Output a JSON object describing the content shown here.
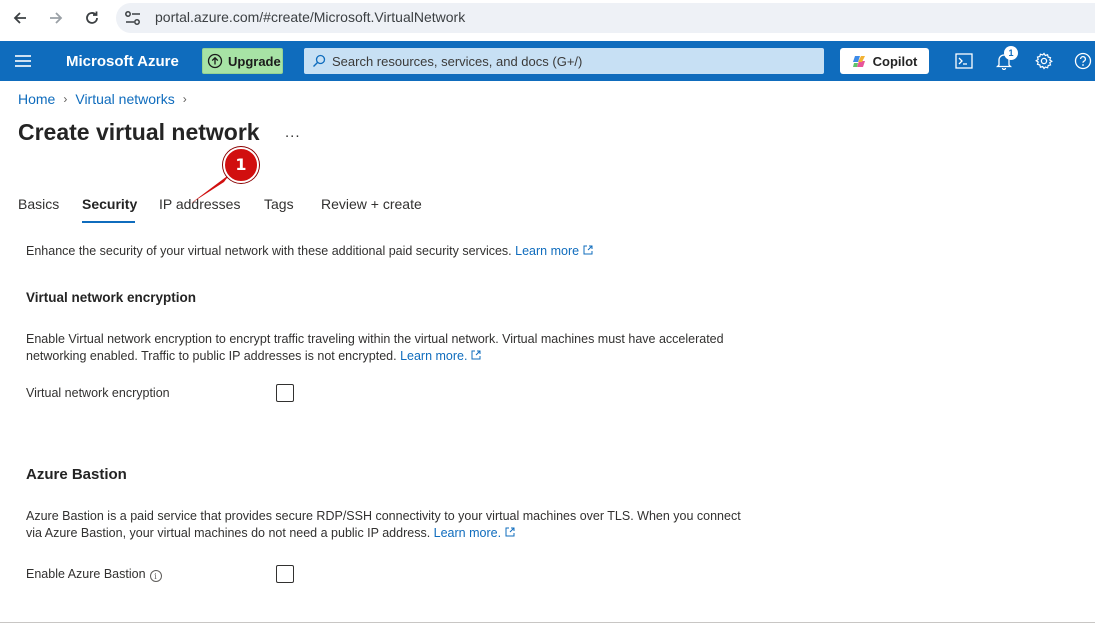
{
  "browser": {
    "url": "portal.azure.com/#create/Microsoft.VirtualNetwork"
  },
  "header": {
    "brand": "Microsoft Azure",
    "upgrade_label": "Upgrade",
    "search_placeholder": "Search resources, services, and docs (G+/)",
    "copilot_label": "Copilot",
    "notification_count": "1",
    "bar_color": "#0f6cbd"
  },
  "breadcrumb": {
    "items": [
      "Home",
      "Virtual networks"
    ]
  },
  "page": {
    "title": "Create virtual network",
    "more": "..."
  },
  "tabs": [
    {
      "label": "Basics",
      "active": false
    },
    {
      "label": "Security",
      "active": true
    },
    {
      "label": "IP addresses",
      "active": false
    },
    {
      "label": "Tags",
      "active": false
    },
    {
      "label": "Review + create",
      "active": false
    }
  ],
  "annotation": {
    "number": "1",
    "color": "#d10f0f"
  },
  "security": {
    "intro": "Enhance the security of your virtual network with these additional paid security services.",
    "intro_link": "Learn more",
    "encryption": {
      "heading": "Virtual network encryption",
      "description_line1": "Enable Virtual network encryption to encrypt traffic traveling within the virtual network. Virtual machines must have accelerated",
      "description_line2": "networking enabled. Traffic to public IP addresses is not encrypted.",
      "link": "Learn more.",
      "field_label": "Virtual network encryption",
      "checked": false
    },
    "bastion": {
      "heading": "Azure Bastion",
      "description_line1": "Azure Bastion is a paid service that provides secure RDP/SSH connectivity to your virtual machines over TLS. When you connect",
      "description_line2": "via Azure Bastion, your virtual machines do not need a public IP address.",
      "link": "Learn more.",
      "field_label": "Enable Azure Bastion",
      "info_glyph": "i",
      "checked": false
    }
  }
}
